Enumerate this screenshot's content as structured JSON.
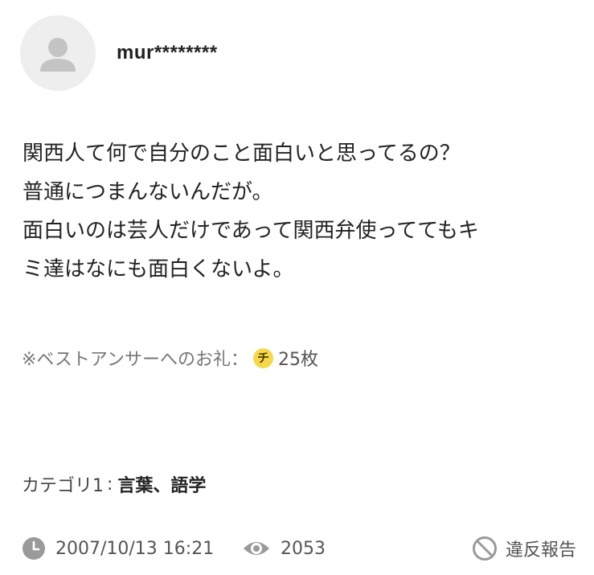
{
  "user": {
    "name": "mur********",
    "avatar_icon": "default-user-icon"
  },
  "question": {
    "lines": [
      "関西人て何で自分のこと面白いと思ってるの？",
      "普通につまんないんだが。",
      "面白いのは芸人だけであって関西弁使っててもキ",
      "ミ達はなにも面白くないよ。"
    ]
  },
  "reward": {
    "label": "※ベストアンサーへのお礼：",
    "coin_glyph": "チ",
    "amount": "25枚",
    "coin_color": "#f6d84a"
  },
  "category": {
    "label": "カテゴリ1",
    "separator": ":",
    "value": "言葉、語学"
  },
  "footer": {
    "date": "2007/10/13 16:21",
    "views": "2053",
    "report_label": "違反報告",
    "icons": {
      "date": "clock-icon",
      "views": "eye-icon",
      "report": "prohibited-icon"
    }
  }
}
